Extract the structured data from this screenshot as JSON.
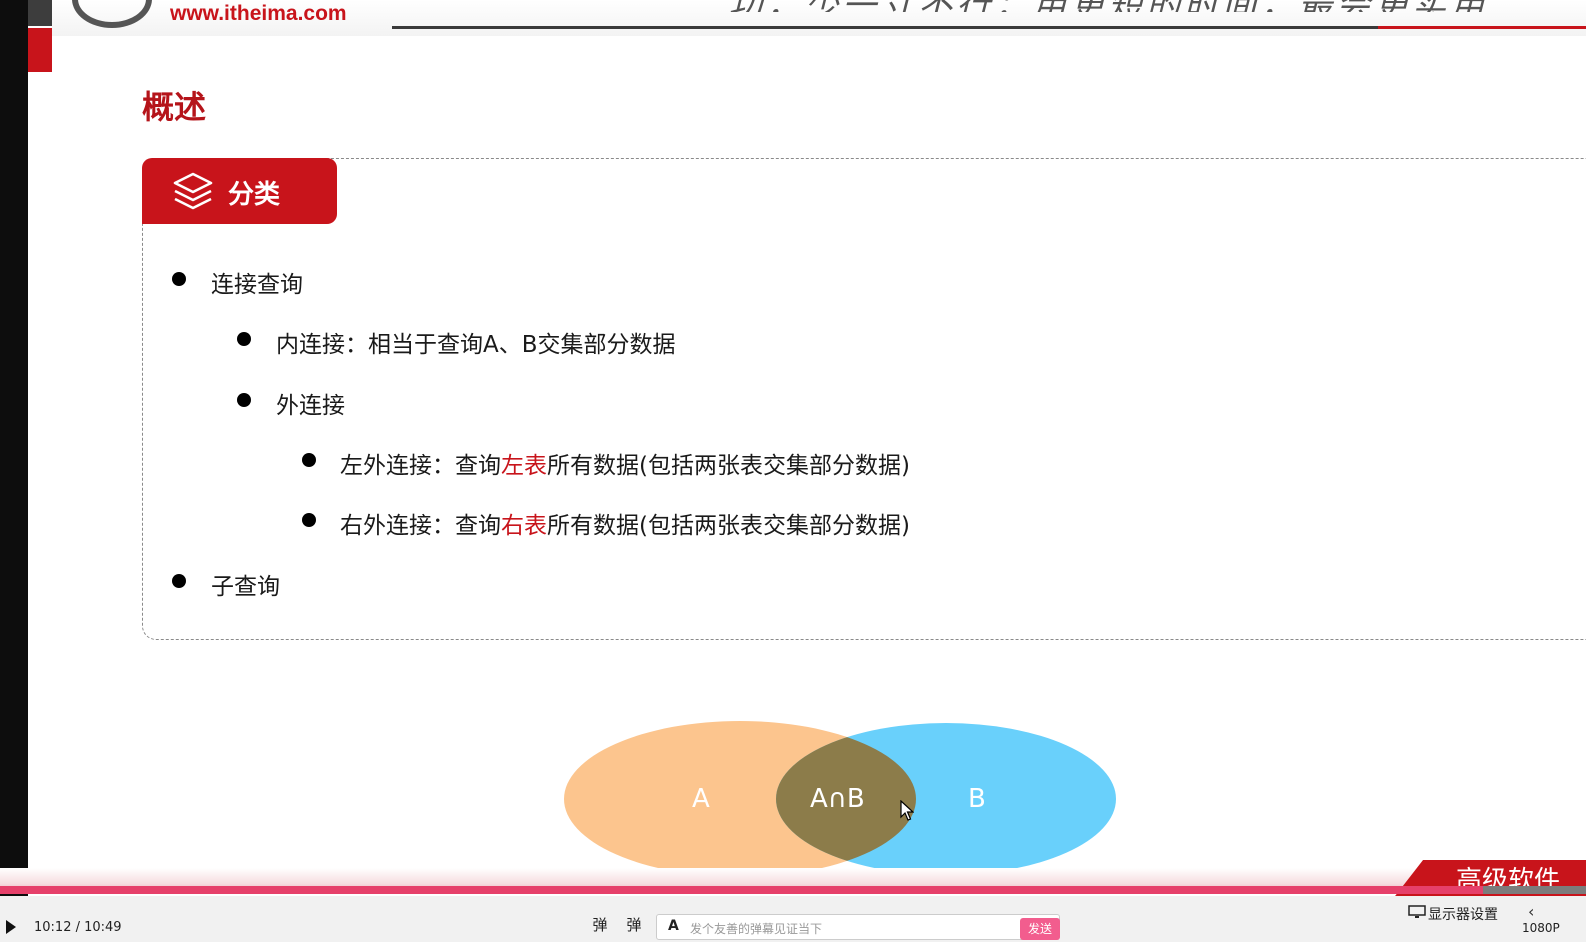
{
  "header": {
    "logo_url": "www.itheima.com",
    "slogan": "…功，少一寸不行；用更短的时间，最会更实用…"
  },
  "page_title": "概述",
  "section_tag": {
    "label": "分类",
    "icon": "layers-icon"
  },
  "list": [
    {
      "level": 1,
      "text": "连接查询"
    },
    {
      "level": 2,
      "text": "内连接：相当于查询A、B交集部分数据"
    },
    {
      "level": 2,
      "text": "外连接"
    },
    {
      "level": 3,
      "prefix": "左外连接：查询",
      "highlight": "左表",
      "suffix": "所有数据(包括两张表交集部分数据)"
    },
    {
      "level": 3,
      "prefix": "右外连接：查询",
      "highlight": "右表",
      "suffix": "所有数据(包括两张表交集部分数据)"
    },
    {
      "level": 1,
      "text": "子查询"
    }
  ],
  "venn": {
    "a_label": "A",
    "intersection_label": "A∩B",
    "b_label": "B",
    "colors": {
      "a": "#fcc58e",
      "b": "#69d0fb",
      "intersection": "#8c7c4a"
    }
  },
  "badge": {
    "text": "高级软件"
  },
  "player": {
    "play_icon": "play-icon",
    "time": "10:12 / 10:49",
    "progress": 0.935,
    "danmu_icons": [
      "danmu-toggle-icon",
      "danmu-settings-icon"
    ],
    "danmu_input_prefix": "A",
    "danmu_placeholder": "发个友善的弹幕见证当下",
    "send_label": "发送",
    "monitor_label": "显示器设置",
    "resolution": "1080P"
  },
  "colors": {
    "brand_red": "#c8141b",
    "title_red": "#b5141a",
    "progress": "#e6406a"
  }
}
